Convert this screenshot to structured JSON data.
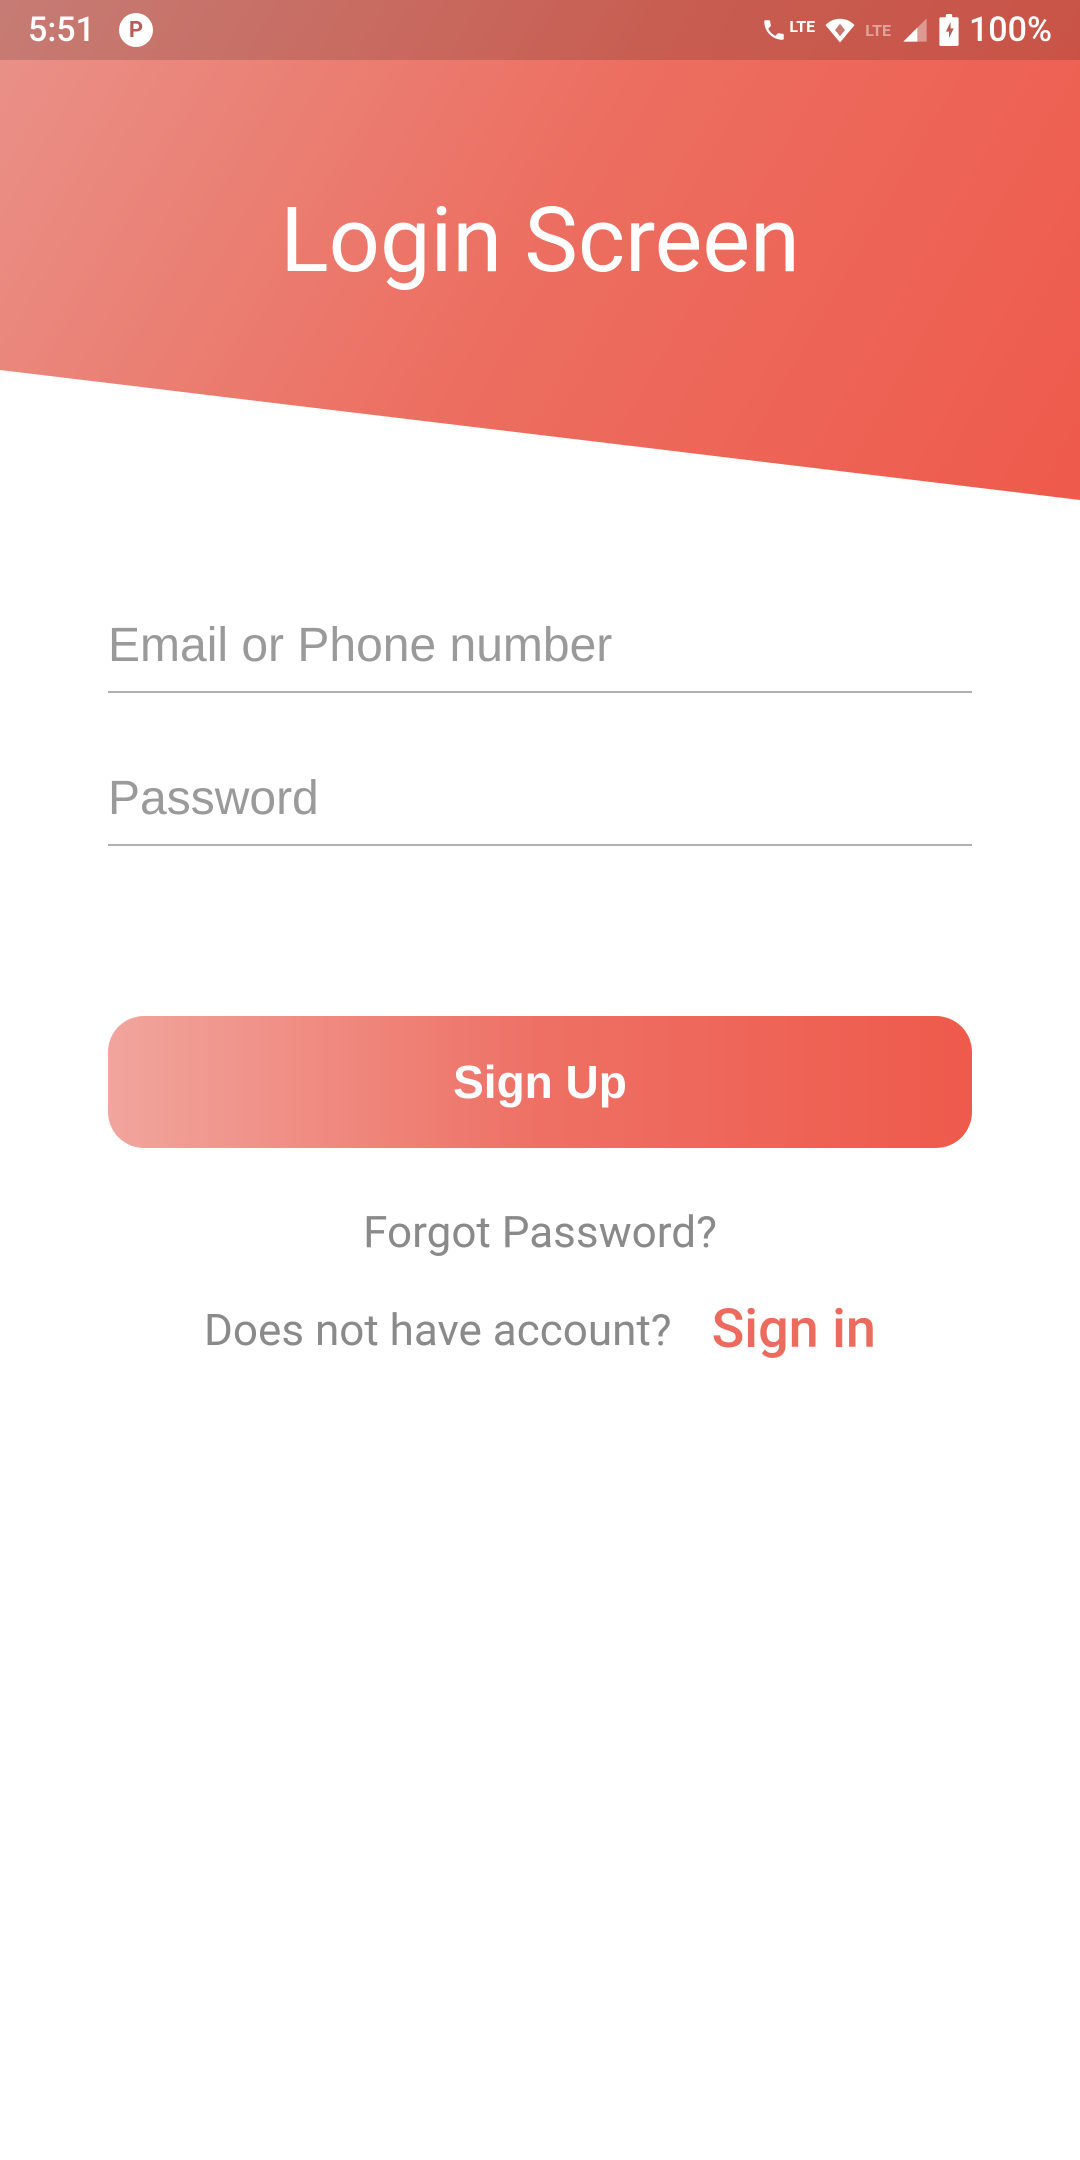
{
  "status_bar": {
    "time": "5:51",
    "lte_label": "LTE",
    "lte_label_dim": "LTE",
    "battery_percent": "100%"
  },
  "header": {
    "title": "Login Screen"
  },
  "form": {
    "email_placeholder": "Email or Phone number",
    "password_placeholder": "Password",
    "signup_button": "Sign Up",
    "forgot_link": "Forgot Password?",
    "signin_prompt": "Does not have account?",
    "signin_link": "Sign in"
  }
}
